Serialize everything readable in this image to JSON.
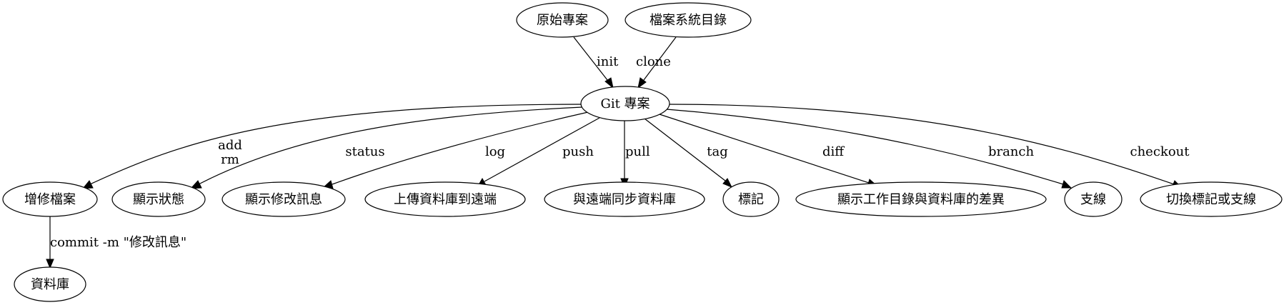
{
  "nodes": {
    "orig": "原始專案",
    "fsdir": "檔案系統目錄",
    "git": "Git 專案",
    "add": "增修檔案",
    "status": "顯示狀態",
    "log": "顯示修改訊息",
    "push": "上傳資料庫到遠端",
    "pull": "與遠端同步資料庫",
    "tag": "標記",
    "diff": "顯示工作目錄與資料庫的差異",
    "branch": "支線",
    "checkout": "切換標記或支線",
    "repo": "資料庫"
  },
  "edges": {
    "init": "init",
    "clone": "clone",
    "add_line1": "add",
    "add_line2": "rm",
    "status": "status",
    "log": "log",
    "push": "push",
    "pull": "pull",
    "tag": "tag",
    "diff": "diff",
    "branch": "branch",
    "checkout": "checkout",
    "commit": "commit -m \"修改訊息\""
  },
  "colors": {
    "stroke": "#000000",
    "fill": "#ffffff"
  }
}
